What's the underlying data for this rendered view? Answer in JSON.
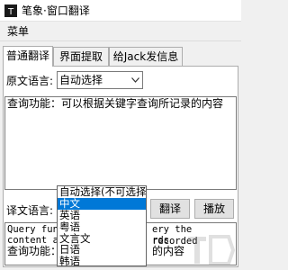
{
  "window": {
    "title": "笔象·窗口翻译"
  },
  "menubar": {
    "menu_label": "菜单"
  },
  "tabs": [
    {
      "label": "普通翻译"
    },
    {
      "label": "界面提取"
    },
    {
      "label": "给Jack发信息"
    }
  ],
  "source": {
    "label": "原文语言:",
    "selected": "自动选择",
    "text": "查询功能：可以根据关键字查询所记录的内容"
  },
  "target": {
    "label": "译文语言:",
    "selected": "中文",
    "translate_label": "翻译",
    "play_label": "播放",
    "output_visible_1": "Query fun",
    "output_visible_1b": "ery the recorded",
    "output_visible_2": "content a",
    "output_visible_2b": "rds",
    "output_visible_3": "查询功能：",
    "output_visible_3b": "的内容"
  },
  "dropdown": {
    "options": [
      "自动选择(不可选择)",
      "中文",
      "英语",
      "粤语",
      "文言文",
      "日语",
      "韩语"
    ],
    "selected_index": 1
  },
  "colors": {
    "selection": "#0078d7",
    "window_bg": "#f0f0f0"
  }
}
